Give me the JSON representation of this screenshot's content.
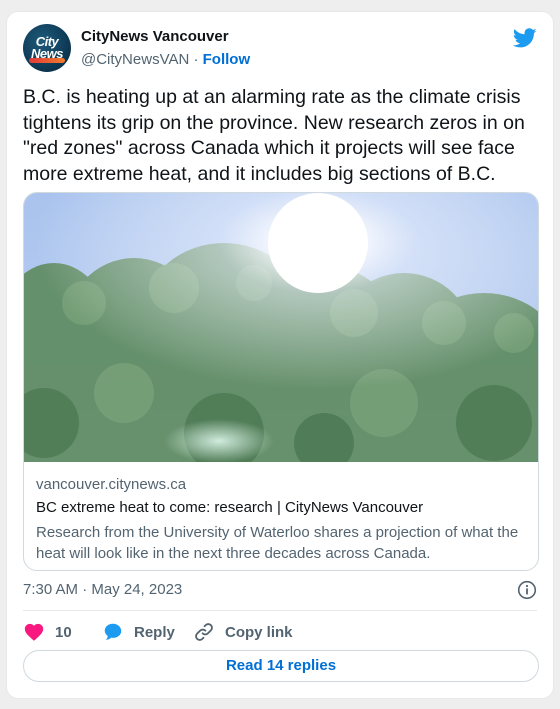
{
  "author": {
    "display_name": "CityNews Vancouver",
    "handle": "@CityNewsVAN",
    "separator": " · ",
    "follow_label": "Follow",
    "avatar_logo_line1": "City",
    "avatar_logo_line2": "News"
  },
  "tweet": {
    "text": "B.C. is heating up at an alarming rate as the climate crisis tightens its grip on the province. New research zeros in on \"red zones\" across Canada which it projects will see face more extreme heat, and it includes big sections of B.C."
  },
  "link_card": {
    "domain": "vancouver.citynews.ca",
    "title": "BC extreme heat to come: research | CityNews Vancouver",
    "description": "Research from the University of Waterloo shares a projection of what the heat will look like in the next three decades across Canada."
  },
  "meta": {
    "timestamp": "7:30 AM · May 24, 2023"
  },
  "actions": {
    "like_count": "10",
    "reply_label": "Reply",
    "copy_link_label": "Copy link"
  },
  "footer": {
    "read_replies_label": "Read 14 replies"
  },
  "colors": {
    "accent": "#006fd6",
    "twitter_blue": "#1d9bf0",
    "like_pink": "#f91880",
    "text_primary": "#0f1419",
    "text_secondary": "#536471"
  },
  "icons": [
    "twitter-bird-icon",
    "info-icon",
    "heart-icon",
    "reply-bubble-icon",
    "link-icon"
  ]
}
